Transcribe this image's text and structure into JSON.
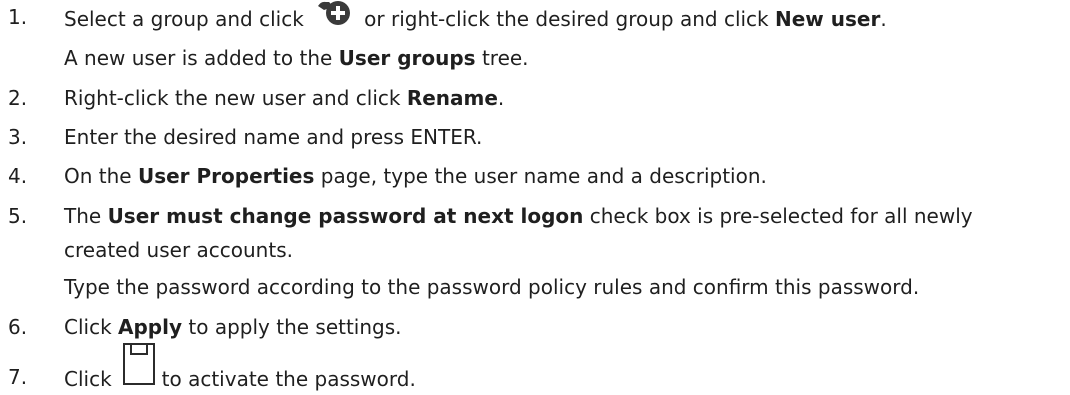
{
  "steps": [
    {
      "number": "1.",
      "part_a": "Select a group and click",
      "part_b": " or right-click the desired group and click ",
      "bold_1": "New user",
      "part_c": ".",
      "sub_a": "A new user is added to the ",
      "sub_bold": "User groups",
      "sub_b": " tree."
    },
    {
      "number": "2.",
      "part_a": "Right-click the new user and click ",
      "bold_1": "Rename",
      "part_b": "."
    },
    {
      "number": "3.",
      "part_a": "Enter the desired name and press ENTER."
    },
    {
      "number": "4.",
      "part_a": "On the ",
      "bold_1": "User Properties",
      "part_b": " page, type the user name and a description."
    },
    {
      "number": "5.",
      "part_a": "The ",
      "bold_1": "User must change password at next logon",
      "part_b": " check box is pre-selected for all newly",
      "cont": "created user accounts.",
      "sub": "Type the password according to the password policy rules and confirm this password."
    },
    {
      "number": "6.",
      "part_a": "Click ",
      "bold_1": "Apply",
      "part_b": " to apply the settings."
    },
    {
      "number": "7.",
      "part_a": "Click",
      "part_b": "to activate the password."
    }
  ],
  "icons": {
    "new_user": "add-user-icon",
    "save": "save-icon"
  }
}
